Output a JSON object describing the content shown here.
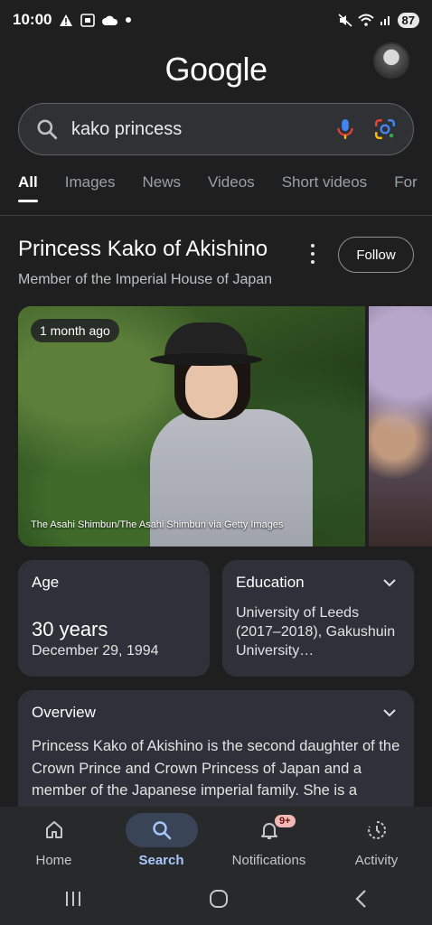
{
  "status_bar": {
    "time": "10:00",
    "battery": "87"
  },
  "logo": "Google",
  "search": {
    "query": "kako princess"
  },
  "tabs": [
    "All",
    "Images",
    "News",
    "Videos",
    "Short videos",
    "For"
  ],
  "entity": {
    "title": "Princess Kako of Akishino",
    "subtitle": "Member of the Imperial House of Japan",
    "follow_label": "Follow"
  },
  "photo": {
    "badge": "1 month ago",
    "credit": "The Asahi Shimbun/The Asahi Shimbun via Getty Images"
  },
  "age_card": {
    "label": "Age",
    "value": "30 years",
    "date": "December 29, 1994"
  },
  "education_card": {
    "label": "Education",
    "text": "University of Leeds (2017–2018), Gakushuin University…"
  },
  "overview_card": {
    "label": "Overview",
    "text": "Princess Kako of Akishino is the second daughter of the Crown Prince and Crown Princess of Japan and a member of the Japanese imperial family. She is a"
  },
  "bottom_nav": {
    "home": "Home",
    "search": "Search",
    "notifications": "Notifications",
    "notifications_badge": "9+",
    "activity": "Activity"
  },
  "colors": {
    "background": "#1f1f1f",
    "card": "#2e3139",
    "accent": "#a8c7fa"
  }
}
